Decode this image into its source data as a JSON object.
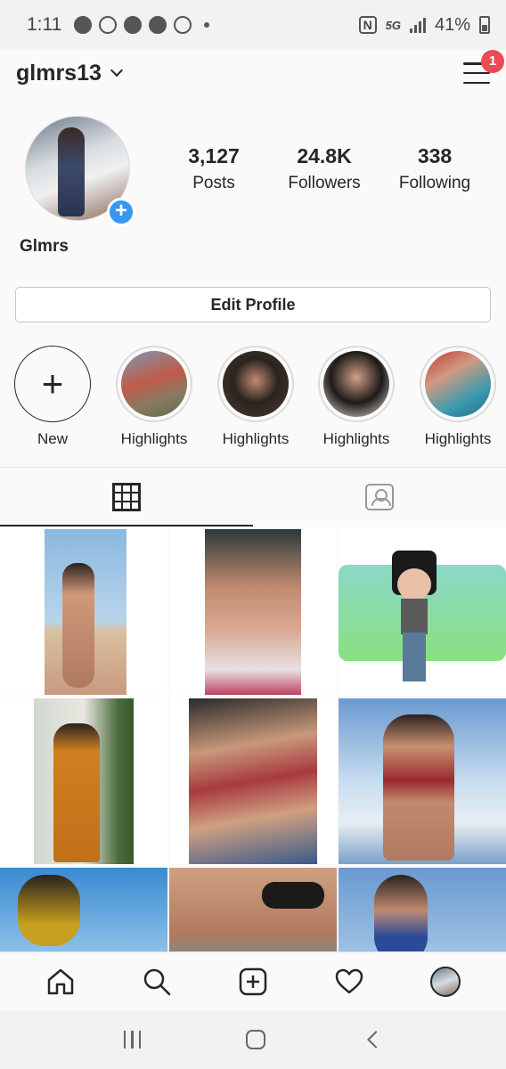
{
  "status_bar": {
    "time": "1:11",
    "network": "5G",
    "battery": "41%"
  },
  "header": {
    "username": "glmrs13",
    "notification_count": "1"
  },
  "profile": {
    "display_name": "Glmrs",
    "stats": [
      {
        "value": "3,127",
        "label": "Posts"
      },
      {
        "value": "24.8K",
        "label": "Followers"
      },
      {
        "value": "338",
        "label": "Following"
      }
    ],
    "edit_button": "Edit Profile"
  },
  "highlights": [
    {
      "label": "New"
    },
    {
      "label": "Highlights"
    },
    {
      "label": "Highlights"
    },
    {
      "label": "Highlights"
    },
    {
      "label": "Highlights"
    }
  ],
  "tabs": {
    "active": "grid",
    "items": [
      "grid-icon",
      "tagged-icon"
    ]
  },
  "bottom_nav": [
    "home-icon",
    "search-icon",
    "add-post-icon",
    "activity-icon",
    "profile-avatar"
  ],
  "system_nav": [
    "recent-apps-icon",
    "home-button-icon",
    "back-icon"
  ],
  "colors": {
    "accent_blue": "#3897f0",
    "badge_red": "#ed4956",
    "text": "#262626"
  }
}
